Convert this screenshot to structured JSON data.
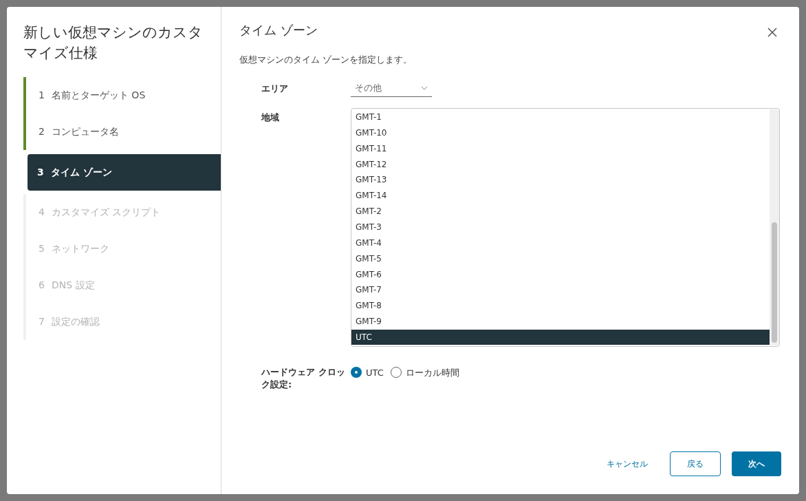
{
  "wizard": {
    "title": "新しい仮想マシンのカスタマイズ仕様",
    "steps": [
      {
        "number": "1",
        "label": "名前とターゲット OS",
        "completed": true,
        "disabled": false,
        "selected": false
      },
      {
        "number": "2",
        "label": "コンピュータ名",
        "completed": true,
        "disabled": false,
        "selected": false
      },
      {
        "number": "3",
        "label": "タイム ゾーン",
        "completed": false,
        "disabled": false,
        "selected": true
      },
      {
        "number": "4",
        "label": "カスタマイズ スクリプト",
        "completed": false,
        "disabled": true,
        "selected": false
      },
      {
        "number": "5",
        "label": "ネットワーク",
        "completed": false,
        "disabled": true,
        "selected": false
      },
      {
        "number": "6",
        "label": "DNS 設定",
        "completed": false,
        "disabled": true,
        "selected": false
      },
      {
        "number": "7",
        "label": "設定の確認",
        "completed": false,
        "disabled": true,
        "selected": false
      }
    ]
  },
  "page": {
    "title": "タイム ゾーン",
    "description": "仮想マシンのタイム ゾーンを指定します。",
    "area": {
      "label": "エリア",
      "value": "その他"
    },
    "region": {
      "label": "地域",
      "options": [
        {
          "label": "GMT-1",
          "selected": false
        },
        {
          "label": "GMT-10",
          "selected": false
        },
        {
          "label": "GMT-11",
          "selected": false
        },
        {
          "label": "GMT-12",
          "selected": false
        },
        {
          "label": "GMT-13",
          "selected": false
        },
        {
          "label": "GMT-14",
          "selected": false
        },
        {
          "label": "GMT-2",
          "selected": false
        },
        {
          "label": "GMT-3",
          "selected": false
        },
        {
          "label": "GMT-4",
          "selected": false
        },
        {
          "label": "GMT-5",
          "selected": false
        },
        {
          "label": "GMT-6",
          "selected": false
        },
        {
          "label": "GMT-7",
          "selected": false
        },
        {
          "label": "GMT-8",
          "selected": false
        },
        {
          "label": "GMT-9",
          "selected": false
        },
        {
          "label": "UTC",
          "selected": true
        }
      ]
    },
    "clock": {
      "label": "ハードウェア クロック設定:",
      "options": [
        {
          "label": "UTC",
          "selected": true
        },
        {
          "label": "ローカル時間",
          "selected": false
        }
      ]
    }
  },
  "buttons": [
    {
      "label": "キャンセル",
      "kind": "link"
    },
    {
      "label": "戻る",
      "kind": "outline"
    },
    {
      "label": "次へ",
      "kind": "primary"
    }
  ]
}
